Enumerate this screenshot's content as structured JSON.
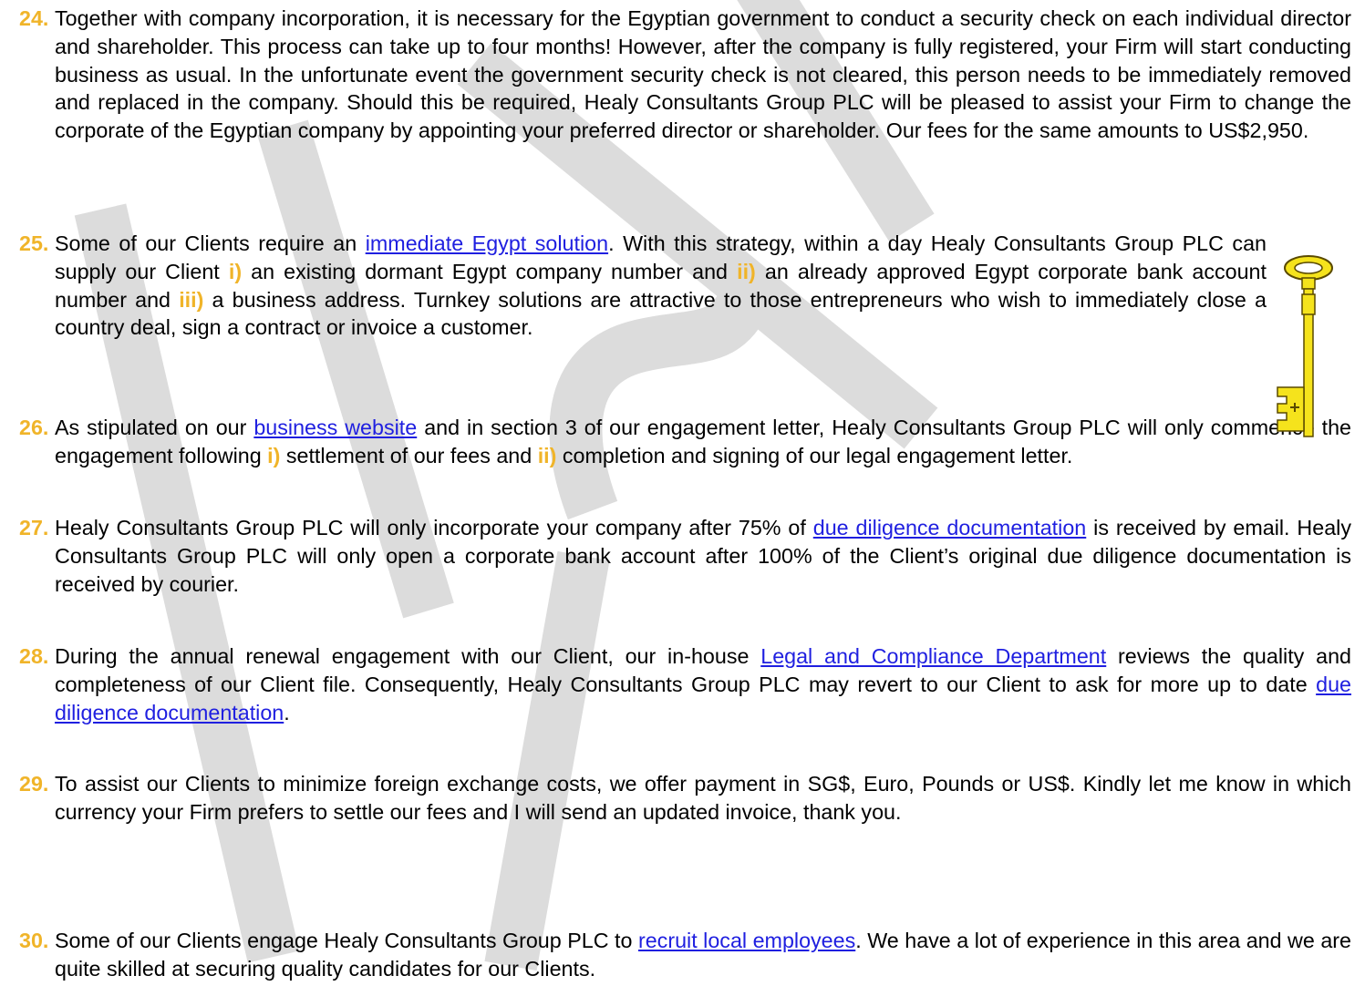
{
  "watermark_text": "DRAFT",
  "items": [
    {
      "number": "24.",
      "text": "Together with company incorporation, it is necessary for the Egyptian government to conduct a security check on each individual director and shareholder. This process can take up to four months! However, after the company is fully registered, your Firm will start conducting business as usual. In the unfortunate event the government security check is not cleared, this person needs to be immediately removed and replaced in the company. Should this be required, Healy Consultants Group PLC will be pleased to assist your Firm to change the corporate of the Egyptian company by appointing your preferred director or shareholder. Our fees for the same amounts to US$2,950."
    },
    {
      "number": "25.",
      "t1": "Some of our Clients require an ",
      "link1": "immediate Egypt solution",
      "t2": ". With this strategy, within a day Healy Consultants Group PLC can supply our Client ",
      "m1": "i)",
      "t3": " an existing dormant Egypt company number and ",
      "m2": "ii)",
      "t4": " an already approved Egypt corporate bank account number and ",
      "m3": "iii)",
      "t5": " a business address. Turnkey solutions are attractive to those entrepreneurs who wish to immediately close a country deal, sign a contract or invoice a customer."
    },
    {
      "number": "26.",
      "t1": "As stipulated on our ",
      "link1": "business website",
      "t2": " and in section 3 of our engagement letter, Healy Consultants Group PLC will only commence the engagement following ",
      "m1": "i)",
      "t3": " settlement of our fees and ",
      "m2": "ii)",
      "t4": " completion and signing of our legal engagement letter."
    },
    {
      "number": "27.",
      "t1": "Healy Consultants Group PLC will only incorporate your company after 75% of ",
      "link1": "due diligence documentation",
      "t2": " is received by email. Healy Consultants Group PLC will only open a corporate bank account after 100% of the Client’s original due diligence documentation is received by courier."
    },
    {
      "number": "28.",
      "t1": "During the annual renewal engagement with our Client, our in-house ",
      "link1": "Legal and Compliance Department",
      "t2": " reviews the quality and completeness of our Client file. Consequently, Healy Consultants Group PLC may revert to our Client to ask for more up to date ",
      "link2": "due diligence documentation",
      "t3": "."
    },
    {
      "number": "29.",
      "text": "To assist our Clients to minimize foreign exchange costs, we offer payment in SG$, Euro, Pounds or US$. Kindly let me know in which currency your Firm prefers to settle our fees and I will send an updated invoice, thank you."
    },
    {
      "number": "30.",
      "t1": "Some of our Clients engage Healy Consultants Group PLC to ",
      "link1": "recruit local employees",
      "t2": ". We have a lot of experience in this area and we are quite skilled at securing quality candidates for our Clients."
    }
  ],
  "colors": {
    "number": "#f0b429",
    "link": "#1f1fe0",
    "watermark": "#d9d9d9",
    "key": "#f5e31c"
  },
  "icons": {
    "key": "key-icon"
  }
}
